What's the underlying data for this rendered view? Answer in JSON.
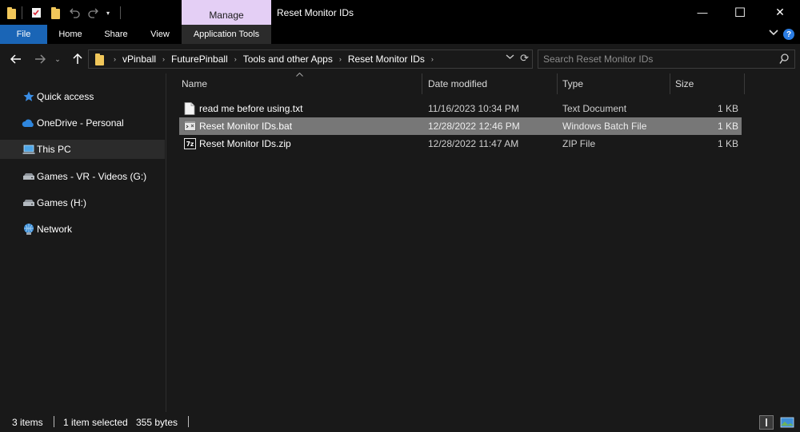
{
  "window": {
    "title": "Reset Monitor IDs",
    "context_tab": "Manage",
    "controls": {
      "minimize": "—",
      "maximize": "☐",
      "close": "✕"
    }
  },
  "ribbon": {
    "tabs": [
      {
        "label": "File"
      },
      {
        "label": "Home"
      },
      {
        "label": "Share"
      },
      {
        "label": "View"
      },
      {
        "label": "Application Tools"
      }
    ],
    "help": "?"
  },
  "address": {
    "breadcrumbs": [
      "vPinball",
      "FuturePinball",
      "Tools and other Apps",
      "Reset Monitor IDs"
    ]
  },
  "search": {
    "placeholder": "Search Reset Monitor IDs"
  },
  "navpane": {
    "items": [
      {
        "label": "Quick access",
        "icon": "star-icon"
      },
      {
        "label": "OneDrive - Personal",
        "icon": "cloud-icon"
      },
      {
        "label": "This PC",
        "icon": "computer-icon"
      },
      {
        "label": "Games - VR - Videos (G:)",
        "icon": "drive-icon"
      },
      {
        "label": "Games (H:)",
        "icon": "drive-icon"
      },
      {
        "label": "Network",
        "icon": "network-icon"
      }
    ]
  },
  "columns": {
    "name": "Name",
    "date": "Date modified",
    "type": "Type",
    "size": "Size"
  },
  "files": [
    {
      "name": "read me before using.txt",
      "date": "11/16/2023 10:34 PM",
      "type": "Text Document",
      "size": "1 KB",
      "icon": "text-file-icon"
    },
    {
      "name": "Reset Monitor IDs.bat",
      "date": "12/28/2022 12:46 PM",
      "type": "Windows Batch File",
      "size": "1 KB",
      "icon": "batch-file-icon"
    },
    {
      "name": "Reset Monitor IDs.zip",
      "date": "12/28/2022 11:47 AM",
      "type": "ZIP File",
      "size": "1 KB",
      "icon": "zip-file-icon"
    }
  ],
  "status": {
    "count": "3 items",
    "selected": "1 item selected",
    "bytes": "355 bytes"
  },
  "colors": {
    "accent": "#1a65b6",
    "manage_tab": "#e4cff5",
    "selected_row": "#777777",
    "background": "#191919"
  }
}
